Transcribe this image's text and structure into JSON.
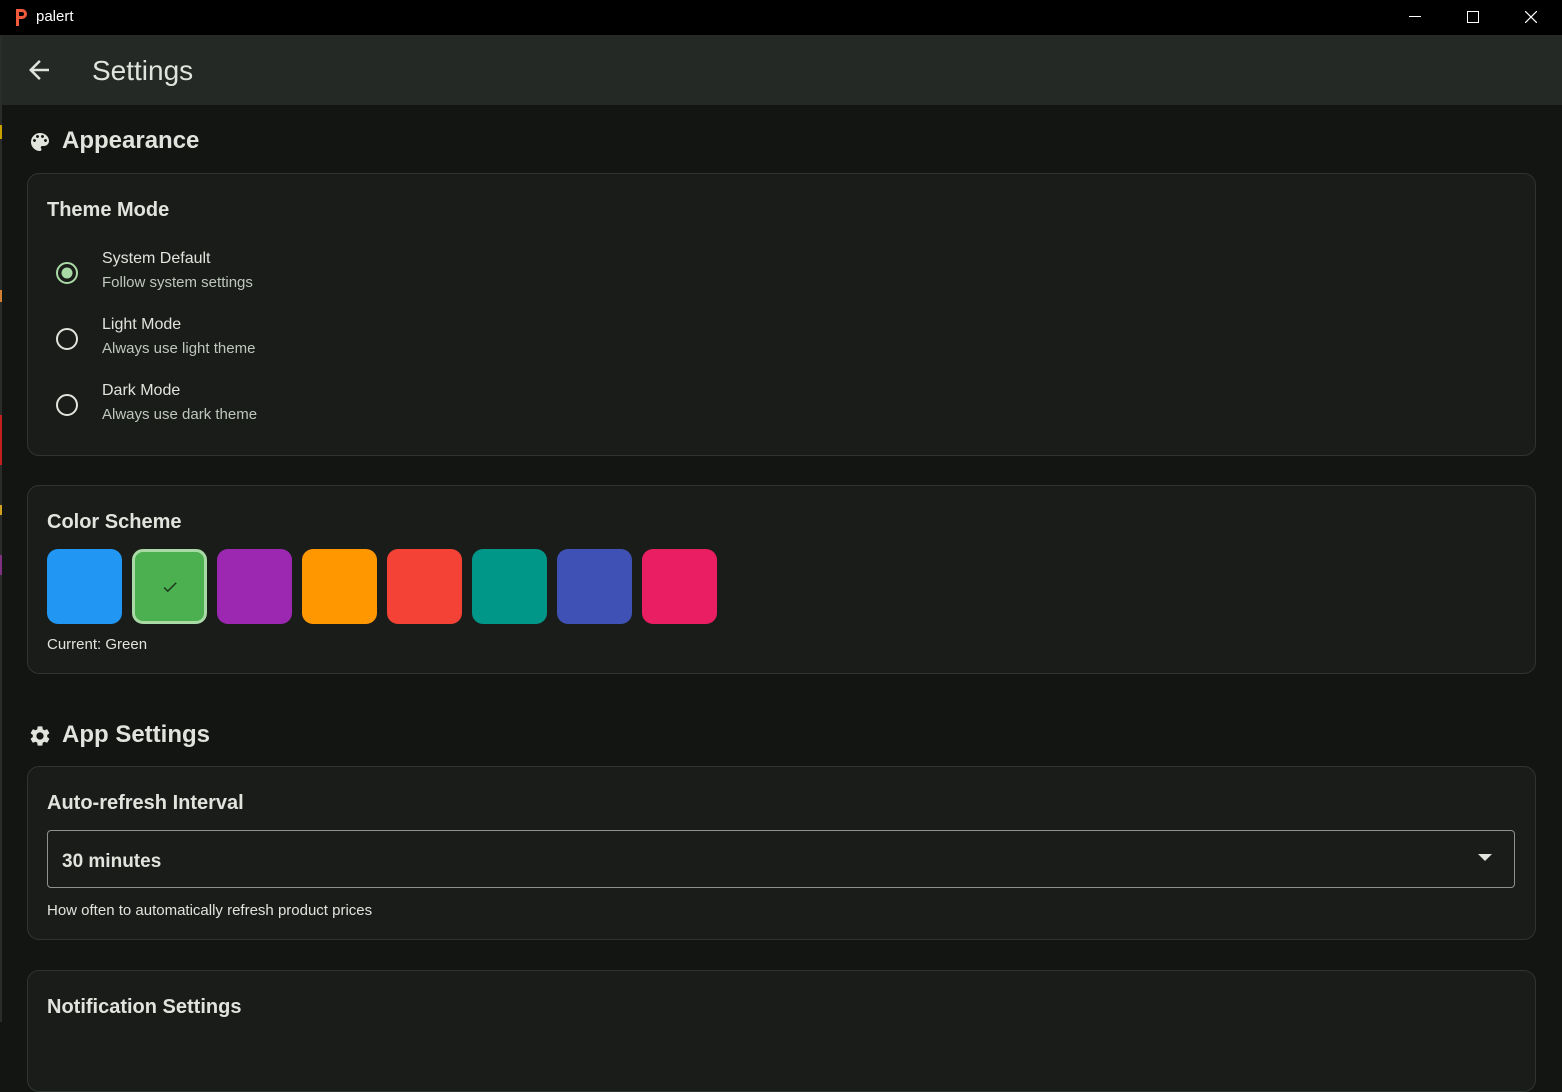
{
  "window": {
    "title": "palert"
  },
  "appbar": {
    "title": "Settings"
  },
  "appearance": {
    "heading": "Appearance",
    "theme_mode": {
      "title": "Theme Mode",
      "options": [
        {
          "label": "System Default",
          "description": "Follow system settings",
          "selected": true
        },
        {
          "label": "Light Mode",
          "description": "Always use light theme",
          "selected": false
        },
        {
          "label": "Dark Mode",
          "description": "Always use dark theme",
          "selected": false
        }
      ]
    },
    "color_scheme": {
      "title": "Color Scheme",
      "swatches": [
        "#2196f3",
        "#4caf50",
        "#9c27b0",
        "#ff9800",
        "#f44336",
        "#009688",
        "#3f51b5",
        "#e91e63"
      ],
      "selected_index": 1,
      "current_label": "Current: Green"
    }
  },
  "app_settings": {
    "heading": "App Settings",
    "auto_refresh": {
      "title": "Auto-refresh Interval",
      "value": "30 minutes",
      "helper": "How often to automatically refresh product prices"
    },
    "notification": {
      "title": "Notification Settings"
    }
  },
  "colors": {
    "accent": "#a9d9a4",
    "background": "#121512",
    "card": "#191c19",
    "appbar": "#252925"
  }
}
